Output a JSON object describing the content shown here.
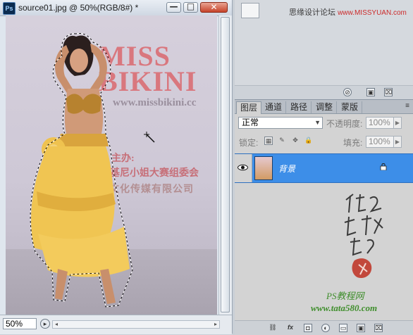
{
  "document": {
    "title": "source01.jpg @ 50%(RGB/8#) *",
    "app_icon": "Ps",
    "zoom": "50%",
    "window_buttons": {
      "minimize": "—",
      "maximize": "□",
      "close": "✕"
    }
  },
  "canvas_image": {
    "backdrop_logo": "MISS\nBIKINI",
    "backdrop_url": "www.missbikini.cc",
    "backdrop_cn_line1": "主办:",
    "backdrop_cn_line2": "基尼小姐大赛组委会",
    "backdrop_cn_line3": "）文化传媒有限公司"
  },
  "top_panel": {
    "watermark": "思缘设计论坛",
    "watermark_url": "www.MISSYUAN.com"
  },
  "layers_panel": {
    "tabs": [
      {
        "label": "图层",
        "active": true
      },
      {
        "label": "通道",
        "active": false
      },
      {
        "label": "路径",
        "active": false
      },
      {
        "label": "调整",
        "active": false
      },
      {
        "label": "蒙版",
        "active": false
      }
    ],
    "blend_mode": "正常",
    "opacity_label": "不透明度:",
    "opacity_value": "100%",
    "lock_label": "锁定:",
    "fill_label": "填充:",
    "fill_value": "100%",
    "layers": [
      {
        "name": "背景",
        "visible": true,
        "locked": true,
        "selected": true
      }
    ],
    "signature_credit": "PS教程网",
    "signature_url": "www.tata580.com"
  },
  "colors": {
    "selection_blue": "#3d8ee8",
    "close_red": "#c6432a",
    "panel_gray": "#d3d3d3",
    "signature_green": "#3f8e2c",
    "signature_red": "#c0392b"
  },
  "icons": {
    "statusbar": "info-circle-icon",
    "eye": "eye-icon",
    "layer_lock": "lock-icon",
    "cursor": "magic-wand-icon",
    "layers_footer": [
      "link-icon",
      "fx-icon",
      "mask-icon",
      "adjustment-icon",
      "group-folder-icon",
      "new-layer-icon",
      "trash-icon"
    ],
    "top_footer": [
      "circle-slash-icon",
      "new-layer-icon",
      "trash-icon"
    ],
    "lock_options": [
      "lock-transparent-icon",
      "lock-image-icon",
      "lock-position-icon",
      "lock-all-icon"
    ]
  }
}
